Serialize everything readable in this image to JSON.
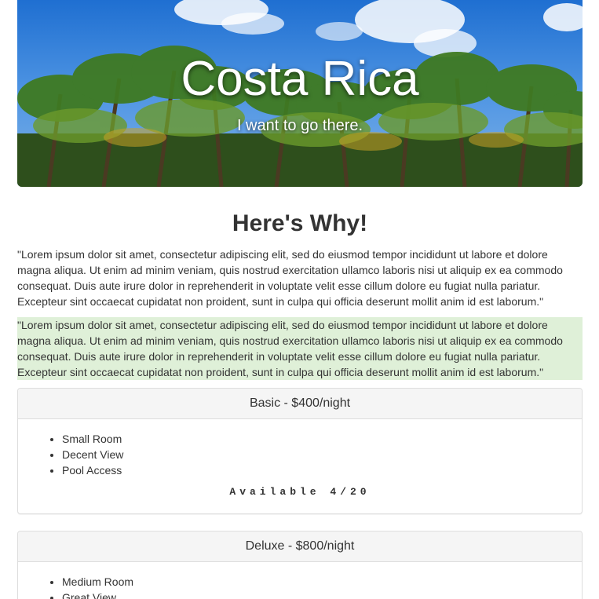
{
  "hero": {
    "title": "Costa Rica",
    "subtitle": "I want to go there."
  },
  "section": {
    "heading": "Here's Why!",
    "paragraphs": [
      "\"Lorem ipsum dolor sit amet, consectetur adipiscing elit, sed do eiusmod tempor incididunt ut labore et dolore magna aliqua. Ut enim ad minim veniam, quis nostrud exercitation ullamco laboris nisi ut aliquip ex ea commodo consequat. Duis aute irure dolor in reprehenderit in voluptate velit esse cillum dolore eu fugiat nulla pariatur. Excepteur sint occaecat cupidatat non proident, sunt in culpa qui officia deserunt mollit anim id est laborum.\"",
      "\"Lorem ipsum dolor sit amet, consectetur adipiscing elit, sed do eiusmod tempor incididunt ut labore et dolore magna aliqua. Ut enim ad minim veniam, quis nostrud exercitation ullamco laboris nisi ut aliquip ex ea commodo consequat. Duis aute irure dolor in reprehenderit in voluptate velit esse cillum dolore eu fugiat nulla pariatur. Excepteur sint occaecat cupidatat non proident, sunt in culpa qui officia deserunt mollit anim id est laborum.\""
    ],
    "highlight_color": "#dff0d8"
  },
  "plans": [
    {
      "title": "Basic - $400/night",
      "features": [
        "Small Room",
        "Decent View",
        "Pool Access"
      ],
      "availability": "Available 4/20"
    },
    {
      "title": "Deluxe - $800/night",
      "features": [
        "Medium Room",
        "Great View"
      ],
      "availability": ""
    }
  ]
}
